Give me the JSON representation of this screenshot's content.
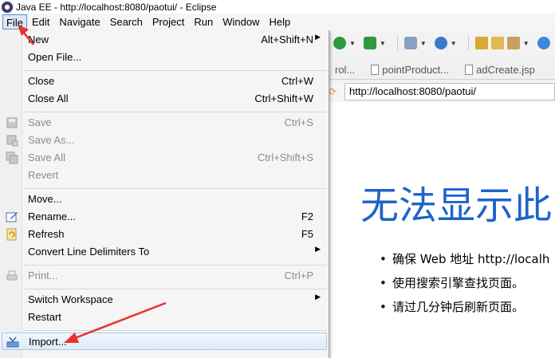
{
  "window": {
    "title": "Java EE - http://localhost:8080/paotui/ - Eclipse"
  },
  "menubar": {
    "items": [
      "File",
      "Edit",
      "Navigate",
      "Search",
      "Project",
      "Run",
      "Window",
      "Help"
    ],
    "active": "File"
  },
  "file_menu": {
    "items": [
      {
        "label": "New",
        "shortcut": "Alt+Shift+N",
        "submenu": true,
        "disabled": false,
        "icon": ""
      },
      {
        "label": "Open File...",
        "shortcut": "",
        "submenu": false,
        "disabled": false,
        "icon": ""
      },
      {
        "label": "Close",
        "shortcut": "Ctrl+W",
        "submenu": false,
        "disabled": false,
        "icon": ""
      },
      {
        "label": "Close All",
        "shortcut": "Ctrl+Shift+W",
        "submenu": false,
        "disabled": false,
        "icon": ""
      },
      {
        "label": "Save",
        "shortcut": "Ctrl+S",
        "submenu": false,
        "disabled": true,
        "icon": "save-icon"
      },
      {
        "label": "Save As...",
        "shortcut": "",
        "submenu": false,
        "disabled": true,
        "icon": "save-as-icon"
      },
      {
        "label": "Save All",
        "shortcut": "Ctrl+Shift+S",
        "submenu": false,
        "disabled": true,
        "icon": "save-all-icon"
      },
      {
        "label": "Revert",
        "shortcut": "",
        "submenu": false,
        "disabled": true,
        "icon": ""
      },
      {
        "label": "Move...",
        "shortcut": "",
        "submenu": false,
        "disabled": false,
        "icon": ""
      },
      {
        "label": "Rename...",
        "shortcut": "F2",
        "submenu": false,
        "disabled": false,
        "icon": "rename-icon"
      },
      {
        "label": "Refresh",
        "shortcut": "F5",
        "submenu": false,
        "disabled": false,
        "icon": "refresh-icon"
      },
      {
        "label": "Convert Line Delimiters To",
        "shortcut": "",
        "submenu": true,
        "disabled": false,
        "icon": ""
      },
      {
        "label": "Print...",
        "shortcut": "Ctrl+P",
        "submenu": false,
        "disabled": true,
        "icon": "print-icon"
      },
      {
        "label": "Switch Workspace",
        "shortcut": "",
        "submenu": true,
        "disabled": false,
        "icon": ""
      },
      {
        "label": "Restart",
        "shortcut": "",
        "submenu": false,
        "disabled": false,
        "icon": ""
      },
      {
        "label": "Import...",
        "shortcut": "",
        "submenu": false,
        "disabled": false,
        "icon": "import-icon",
        "highlighted": true
      }
    ]
  },
  "editor_tabs": [
    "rol...",
    "pointProduct...",
    "adCreate.jsp"
  ],
  "browser": {
    "url": "http://localhost:8080/paotui/",
    "error_title": "无法显示此",
    "bullets": [
      "确保 Web 地址 http://localh",
      "使用搜索引擎查找页面。",
      "请过几分钟后刷新页面。"
    ]
  },
  "colors": {
    "error_title": "#1e64c8",
    "annotation_arrow": "#e8312f",
    "menu_highlight_border": "#a8c8ec"
  }
}
